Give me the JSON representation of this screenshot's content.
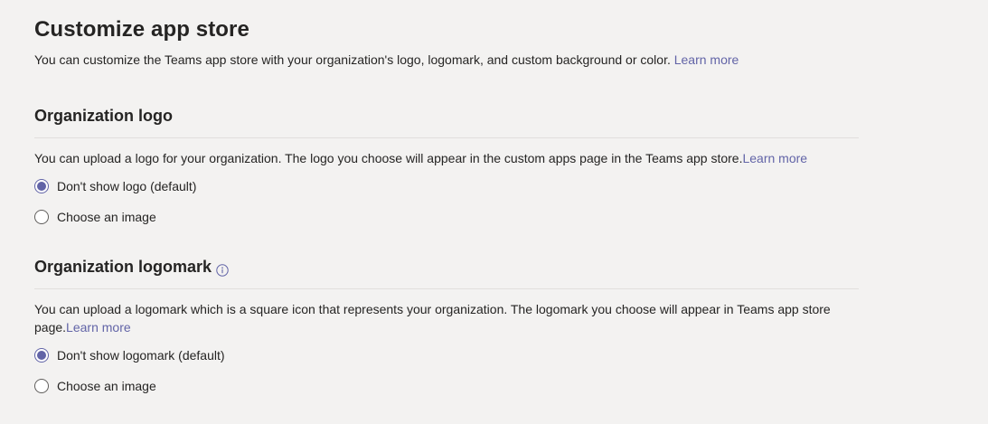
{
  "header": {
    "title": "Customize app store",
    "description": "You can customize the Teams app store with your organization's logo, logomark, and custom background or color.",
    "learn_more": "Learn more"
  },
  "logo_section": {
    "title": "Organization logo",
    "description": "You can upload a logo for your organization. The logo you choose will appear in the custom apps page in the Teams app store.",
    "learn_more": "Learn more",
    "options": [
      {
        "label": "Don't show logo (default)",
        "selected": true
      },
      {
        "label": "Choose an image",
        "selected": false
      }
    ]
  },
  "logomark_section": {
    "title": "Organization logomark",
    "info_icon": "info-icon",
    "description": "You can upload a logomark which is a square icon that represents your organization. The logomark you choose will appear in Teams app store page.",
    "learn_more": "Learn more",
    "options": [
      {
        "label": "Don't show logomark (default)",
        "selected": true
      },
      {
        "label": "Choose an image",
        "selected": false
      }
    ]
  },
  "colors": {
    "background": "#f3f2f1",
    "accent": "#6264a7",
    "text": "#252423",
    "divider": "#e1dfdd"
  }
}
